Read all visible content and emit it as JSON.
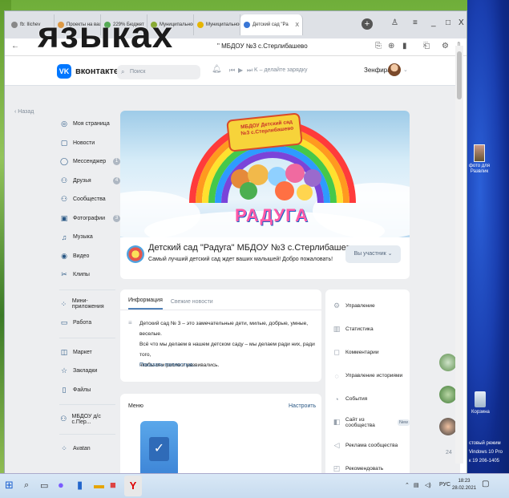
{
  "overlay_text": "языках",
  "browser": {
    "tabs": [
      {
        "label": "fb: Ilichev",
        "color": "#888"
      },
      {
        "label": "Проекты на ваш",
        "color": "#d94"
      },
      {
        "label": "229% Бюджет",
        "color": "#5a5"
      },
      {
        "label": "Муниципальное о",
        "color": "#8a3"
      },
      {
        "label": "Муниципальное ",
        "color": "#e6b500"
      },
      {
        "label": "Детский сад \"Ра",
        "color": "#3a77d6",
        "active": true
      }
    ],
    "url": "\" МБДОУ №3 с.Стерлибашево",
    "close_tab": "X",
    "new_tab": "+",
    "window_min": "_",
    "window_max": "□",
    "window_close": "X"
  },
  "vk": {
    "brand": "вконтакте",
    "logo_letter": "VK",
    "search_placeholder": "Поиск",
    "player_text": "K – делайте зарядку",
    "user_name": "Зенфира",
    "back_label": "Назад",
    "nav": [
      {
        "icon": "user-icon",
        "glyph": "◎",
        "label": "Моя страница"
      },
      {
        "icon": "news-icon",
        "glyph": "▢",
        "label": "Новости"
      },
      {
        "icon": "messenger-icon",
        "glyph": "◯",
        "label": "Мессенджер",
        "badge": "1"
      },
      {
        "icon": "friends-icon",
        "glyph": "⚇",
        "label": "Друзья",
        "badge": "4"
      },
      {
        "icon": "groups-icon",
        "glyph": "⚇",
        "label": "Сообщества"
      },
      {
        "icon": "photos-icon",
        "glyph": "▣",
        "label": "Фотографии",
        "badge": "3"
      },
      {
        "icon": "music-icon",
        "glyph": "♫",
        "label": "Музыка"
      },
      {
        "icon": "video-icon",
        "glyph": "◉",
        "label": "Видео"
      },
      {
        "icon": "clips-icon",
        "glyph": "✂",
        "label": "Клипы"
      },
      {
        "sep": true
      },
      {
        "icon": "apps-icon",
        "glyph": "⁘",
        "label": "Мини-приложения"
      },
      {
        "icon": "work-icon",
        "glyph": "▭",
        "label": "Работа"
      },
      {
        "sep": true
      },
      {
        "icon": "market-icon",
        "glyph": "◫",
        "label": "Маркет"
      },
      {
        "icon": "bookmarks-icon",
        "glyph": "☆",
        "label": "Закладки"
      },
      {
        "icon": "files-icon",
        "glyph": "▯",
        "label": "Файлы"
      },
      {
        "sep": true
      },
      {
        "icon": "community-icon",
        "glyph": "⚇",
        "label": "МБДОУ д/с с.Пер..."
      },
      {
        "sep": true
      },
      {
        "icon": "avatan-icon",
        "glyph": "⁘",
        "label": "Avatan"
      }
    ],
    "cover": {
      "banner_line1": "МБДОУ Детский сад",
      "banner_line2": "№3 с.Стерлибашево",
      "word": "РАДУГА"
    },
    "group": {
      "name": "Детский сад \"Радуга\" МБДОУ №3 с.Стерлибашево",
      "status": "Самый лучший детский сад ждет ваших малышей! Добро пожаловать!",
      "member_button": "Вы участник ⌄"
    },
    "info": {
      "tab_info": "Информация",
      "tab_news": "Свежие новости",
      "description_lines": [
        "Детский сад № 3 – это замечательные дети, милые, добрые, умные, веселые.",
        "Всё что мы делаем в нашем детском саду – мы делаем ради них, ради того,",
        "чтобы они росли и развивались."
      ],
      "show_more": "Показать полностью..."
    },
    "menu": {
      "title": "Меню",
      "configure": "Настроить"
    },
    "side": [
      {
        "icon": "settings-icon",
        "glyph": "⚙",
        "label": "Управление"
      },
      {
        "icon": "stats-icon",
        "glyph": "▥",
        "label": "Статистика"
      },
      {
        "icon": "comments-icon",
        "glyph": "◻",
        "label": "Комментарии"
      },
      {
        "icon": "stories-icon",
        "glyph": "◌",
        "label": "Управление историями"
      },
      {
        "icon": "events-icon",
        "glyph": "◔",
        "label": "События"
      },
      {
        "icon": "site-icon",
        "glyph": "◧",
        "label": "Сайт из сообщества",
        "new": "New"
      },
      {
        "icon": "ads-icon",
        "glyph": "◁",
        "label": "Реклама сообщества"
      },
      {
        "icon": "recommend-icon",
        "glyph": "◰",
        "label": "Рекомендовать"
      }
    ],
    "friend_count": "24"
  },
  "desktop": {
    "icon1": "фото для Развлик",
    "recycle": "Корзина",
    "windows_notice_1": "стовый режим",
    "windows_notice_2": "Vindows 10 Pro",
    "windows_notice_3": "к 19 206-1405"
  },
  "taskbar": {
    "lang": "РУС",
    "time": "18:23",
    "date": "28.02.2021"
  }
}
